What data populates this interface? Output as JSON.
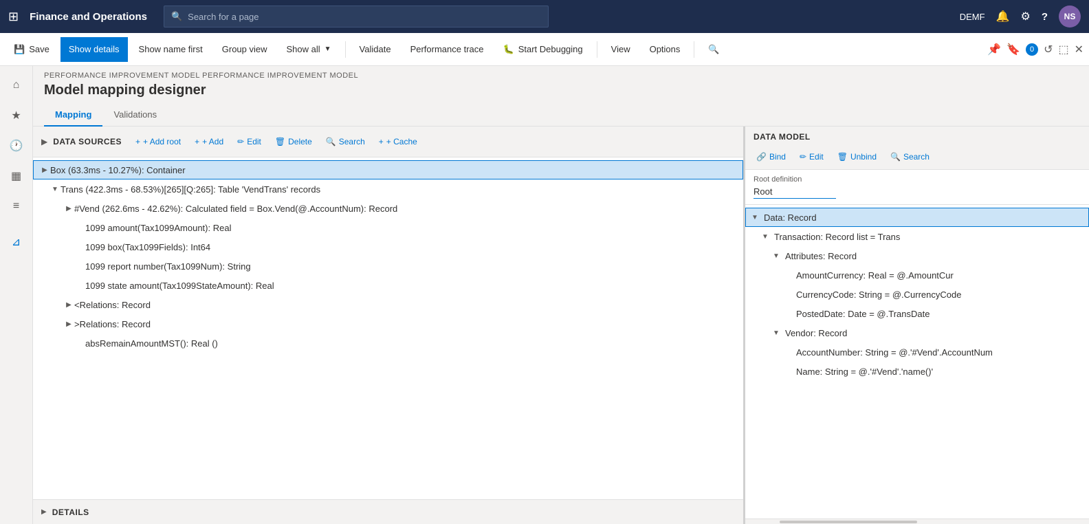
{
  "app": {
    "name": "Finance and Operations",
    "avatar": "NS",
    "env": "DEMF"
  },
  "searchbar": {
    "placeholder": "Search for a page"
  },
  "commandbar": {
    "save": "Save",
    "showDetails": "Show details",
    "showNameFirst": "Show name first",
    "groupView": "Group view",
    "showAll": "Show all",
    "validate": "Validate",
    "performanceTrace": "Performance trace",
    "startDebugging": "Start Debugging",
    "view": "View",
    "options": "Options"
  },
  "breadcrumb": "PERFORMANCE IMPROVEMENT MODEL PERFORMANCE IMPROVEMENT MODEL",
  "pageTitle": "Model mapping designer",
  "tabs": {
    "mapping": "Mapping",
    "validations": "Validations"
  },
  "dataSources": {
    "sectionTitle": "DATA SOURCES",
    "toolbar": {
      "addRoot": "+ Add root",
      "add": "+ Add",
      "edit": "Edit",
      "delete": "Delete",
      "search": "Search",
      "cache": "+ Cache"
    },
    "items": [
      {
        "id": "box",
        "label": "Box (63.3ms - 10.27%): Container",
        "level": 0,
        "hasChildren": true,
        "expanded": true,
        "selected": true
      },
      {
        "id": "trans",
        "label": "Trans (422.3ms - 68.53%)[265][Q:265]: Table 'VendTrans' records",
        "level": 1,
        "hasChildren": true,
        "expanded": true,
        "selected": false
      },
      {
        "id": "vend",
        "label": "#Vend (262.6ms - 42.62%): Calculated field = Box.Vend(@.AccountNum): Record",
        "level": 2,
        "hasChildren": true,
        "expanded": false,
        "selected": false
      },
      {
        "id": "amount1099",
        "label": "1099 amount(Tax1099Amount): Real",
        "level": 3,
        "hasChildren": false,
        "expanded": false,
        "selected": false
      },
      {
        "id": "box1099",
        "label": "1099 box(Tax1099Fields): Int64",
        "level": 3,
        "hasChildren": false,
        "expanded": false,
        "selected": false
      },
      {
        "id": "reportnum",
        "label": "1099 report number(Tax1099Num): String",
        "level": 3,
        "hasChildren": false,
        "expanded": false,
        "selected": false
      },
      {
        "id": "stateamount",
        "label": "1099 state amount(Tax1099StateAmount): Real",
        "level": 3,
        "hasChildren": false,
        "expanded": false,
        "selected": false
      },
      {
        "id": "relationslt",
        "label": "<Relations: Record",
        "level": 2,
        "hasChildren": true,
        "expanded": false,
        "selected": false
      },
      {
        "id": "relationsgt",
        "label": ">Relations: Record",
        "level": 2,
        "hasChildren": true,
        "expanded": false,
        "selected": false
      },
      {
        "id": "absremain",
        "label": "absRemainAmountMST(): Real ()",
        "level": 3,
        "hasChildren": false,
        "expanded": false,
        "selected": false
      }
    ]
  },
  "dataModel": {
    "sectionTitle": "DATA MODEL",
    "toolbar": {
      "bind": "Bind",
      "edit": "Edit",
      "unbind": "Unbind",
      "search": "Search"
    },
    "rootDefinition": {
      "label": "Root definition",
      "value": "Root"
    },
    "items": [
      {
        "id": "data",
        "label": "Data: Record",
        "level": 0,
        "hasChildren": true,
        "expanded": true,
        "selected": true
      },
      {
        "id": "transaction",
        "label": "Transaction: Record list = Trans",
        "level": 1,
        "hasChildren": true,
        "expanded": true,
        "selected": false
      },
      {
        "id": "attributes",
        "label": "Attributes: Record",
        "level": 2,
        "hasChildren": true,
        "expanded": true,
        "selected": false
      },
      {
        "id": "amountcurrency",
        "label": "AmountCurrency: Real = @.AmountCur",
        "level": 3,
        "hasChildren": false,
        "expanded": false,
        "selected": false
      },
      {
        "id": "currencycode",
        "label": "CurrencyCode: String = @.CurrencyCode",
        "level": 3,
        "hasChildren": false,
        "expanded": false,
        "selected": false
      },
      {
        "id": "posteddate",
        "label": "PostedDate: Date = @.TransDate",
        "level": 3,
        "hasChildren": false,
        "expanded": false,
        "selected": false
      },
      {
        "id": "vendor",
        "label": "Vendor: Record",
        "level": 2,
        "hasChildren": true,
        "expanded": true,
        "selected": false
      },
      {
        "id": "accountnumber",
        "label": "AccountNumber: String = @.'#Vend'.AccountNum",
        "level": 3,
        "hasChildren": false,
        "expanded": false,
        "selected": false
      },
      {
        "id": "name",
        "label": "Name: String = @.'#Vend'.'name()'",
        "level": 3,
        "hasChildren": false,
        "expanded": false,
        "selected": false
      }
    ]
  },
  "details": {
    "label": "DETAILS"
  },
  "icons": {
    "grid": "⊞",
    "search": "🔍",
    "bell": "🔔",
    "gear": "⚙",
    "question": "?",
    "home": "⌂",
    "star": "★",
    "clock": "🕐",
    "table": "▦",
    "list": "≡",
    "funnel": "⊿",
    "collapse": "▶",
    "expand": "▼",
    "chevronRight": "▶",
    "chevronDown": "▼",
    "bug": "🐛",
    "link": "🔗",
    "edit": "✏",
    "trash": "🗑",
    "plus": "+",
    "pin": "📌",
    "badge": "🔖",
    "refresh": "↺",
    "open": "⬚",
    "close": "✕"
  }
}
